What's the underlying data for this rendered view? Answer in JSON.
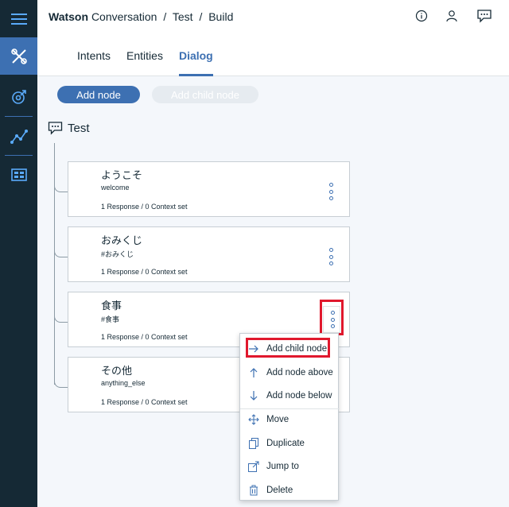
{
  "rail": {
    "items": [
      {
        "name": "menu-icon"
      },
      {
        "name": "tools-icon"
      },
      {
        "name": "improve-icon"
      },
      {
        "name": "analytics-icon"
      },
      {
        "name": "deploy-icon"
      }
    ]
  },
  "header": {
    "brand": "Watson",
    "app": "Conversation",
    "sep1": "/",
    "workspace": "Test",
    "sep2": "/",
    "page": "Build",
    "icons": [
      "info-icon",
      "user-icon",
      "chat-icon"
    ]
  },
  "tabs": [
    "Intents",
    "Entities",
    "Dialog"
  ],
  "active_tab": "Dialog",
  "toolbar": {
    "add_node": "Add node",
    "add_child_node": "Add child node"
  },
  "tree": {
    "root_label": "Test",
    "nodes": [
      {
        "title": "ようこそ",
        "condition": "welcome",
        "meta": "1 Response / 0 Context set"
      },
      {
        "title": "おみくじ",
        "condition": "#おみくじ",
        "meta": "1 Response / 0 Context set"
      },
      {
        "title": "食事",
        "condition": "#食事",
        "meta": "1 Response / 0 Context set"
      },
      {
        "title": "その他",
        "condition": "anything_else",
        "meta": "1 Response / 0 Context set"
      }
    ]
  },
  "context_menu": {
    "items": [
      {
        "label": "Add child node",
        "icon": "arrow-right-icon"
      },
      {
        "label": "Add node above",
        "icon": "arrow-up-icon"
      },
      {
        "label": "Add node below",
        "icon": "arrow-down-icon"
      },
      {
        "label": "Move",
        "icon": "move-icon"
      },
      {
        "label": "Duplicate",
        "icon": "duplicate-icon"
      },
      {
        "label": "Jump to",
        "icon": "jump-to-icon"
      },
      {
        "label": "Delete",
        "icon": "trash-icon"
      }
    ]
  },
  "colors": {
    "accent": "#3d70b2",
    "rail": "#152935",
    "highlight": "#e0182d"
  }
}
